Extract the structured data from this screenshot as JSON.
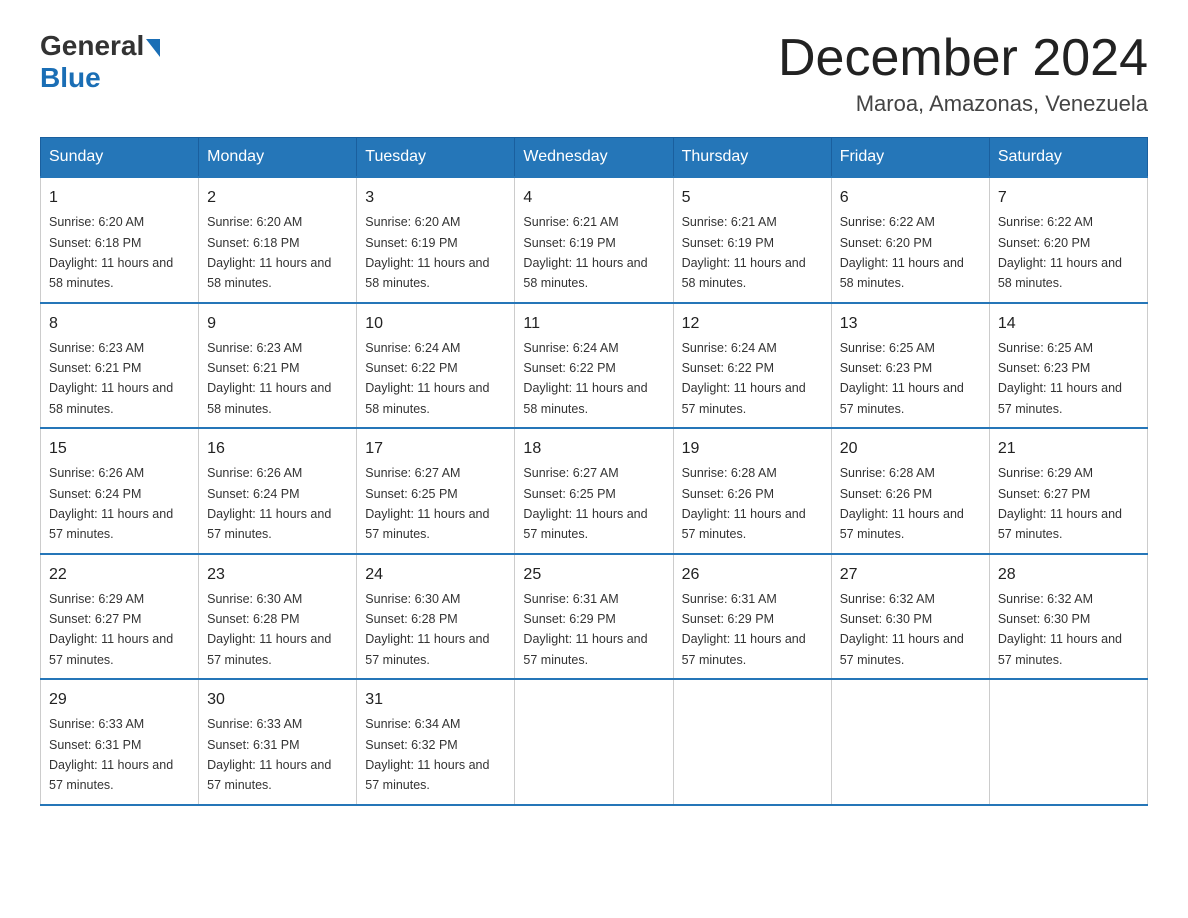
{
  "logo": {
    "general": "General",
    "blue": "Blue"
  },
  "title": "December 2024",
  "subtitle": "Maroa, Amazonas, Venezuela",
  "days_of_week": [
    "Sunday",
    "Monday",
    "Tuesday",
    "Wednesday",
    "Thursday",
    "Friday",
    "Saturday"
  ],
  "weeks": [
    [
      {
        "day": "1",
        "sunrise": "6:20 AM",
        "sunset": "6:18 PM",
        "daylight": "11 hours and 58 minutes."
      },
      {
        "day": "2",
        "sunrise": "6:20 AM",
        "sunset": "6:18 PM",
        "daylight": "11 hours and 58 minutes."
      },
      {
        "day": "3",
        "sunrise": "6:20 AM",
        "sunset": "6:19 PM",
        "daylight": "11 hours and 58 minutes."
      },
      {
        "day": "4",
        "sunrise": "6:21 AM",
        "sunset": "6:19 PM",
        "daylight": "11 hours and 58 minutes."
      },
      {
        "day": "5",
        "sunrise": "6:21 AM",
        "sunset": "6:19 PM",
        "daylight": "11 hours and 58 minutes."
      },
      {
        "day": "6",
        "sunrise": "6:22 AM",
        "sunset": "6:20 PM",
        "daylight": "11 hours and 58 minutes."
      },
      {
        "day": "7",
        "sunrise": "6:22 AM",
        "sunset": "6:20 PM",
        "daylight": "11 hours and 58 minutes."
      }
    ],
    [
      {
        "day": "8",
        "sunrise": "6:23 AM",
        "sunset": "6:21 PM",
        "daylight": "11 hours and 58 minutes."
      },
      {
        "day": "9",
        "sunrise": "6:23 AM",
        "sunset": "6:21 PM",
        "daylight": "11 hours and 58 minutes."
      },
      {
        "day": "10",
        "sunrise": "6:24 AM",
        "sunset": "6:22 PM",
        "daylight": "11 hours and 58 minutes."
      },
      {
        "day": "11",
        "sunrise": "6:24 AM",
        "sunset": "6:22 PM",
        "daylight": "11 hours and 58 minutes."
      },
      {
        "day": "12",
        "sunrise": "6:24 AM",
        "sunset": "6:22 PM",
        "daylight": "11 hours and 57 minutes."
      },
      {
        "day": "13",
        "sunrise": "6:25 AM",
        "sunset": "6:23 PM",
        "daylight": "11 hours and 57 minutes."
      },
      {
        "day": "14",
        "sunrise": "6:25 AM",
        "sunset": "6:23 PM",
        "daylight": "11 hours and 57 minutes."
      }
    ],
    [
      {
        "day": "15",
        "sunrise": "6:26 AM",
        "sunset": "6:24 PM",
        "daylight": "11 hours and 57 minutes."
      },
      {
        "day": "16",
        "sunrise": "6:26 AM",
        "sunset": "6:24 PM",
        "daylight": "11 hours and 57 minutes."
      },
      {
        "day": "17",
        "sunrise": "6:27 AM",
        "sunset": "6:25 PM",
        "daylight": "11 hours and 57 minutes."
      },
      {
        "day": "18",
        "sunrise": "6:27 AM",
        "sunset": "6:25 PM",
        "daylight": "11 hours and 57 minutes."
      },
      {
        "day": "19",
        "sunrise": "6:28 AM",
        "sunset": "6:26 PM",
        "daylight": "11 hours and 57 minutes."
      },
      {
        "day": "20",
        "sunrise": "6:28 AM",
        "sunset": "6:26 PM",
        "daylight": "11 hours and 57 minutes."
      },
      {
        "day": "21",
        "sunrise": "6:29 AM",
        "sunset": "6:27 PM",
        "daylight": "11 hours and 57 minutes."
      }
    ],
    [
      {
        "day": "22",
        "sunrise": "6:29 AM",
        "sunset": "6:27 PM",
        "daylight": "11 hours and 57 minutes."
      },
      {
        "day": "23",
        "sunrise": "6:30 AM",
        "sunset": "6:28 PM",
        "daylight": "11 hours and 57 minutes."
      },
      {
        "day": "24",
        "sunrise": "6:30 AM",
        "sunset": "6:28 PM",
        "daylight": "11 hours and 57 minutes."
      },
      {
        "day": "25",
        "sunrise": "6:31 AM",
        "sunset": "6:29 PM",
        "daylight": "11 hours and 57 minutes."
      },
      {
        "day": "26",
        "sunrise": "6:31 AM",
        "sunset": "6:29 PM",
        "daylight": "11 hours and 57 minutes."
      },
      {
        "day": "27",
        "sunrise": "6:32 AM",
        "sunset": "6:30 PM",
        "daylight": "11 hours and 57 minutes."
      },
      {
        "day": "28",
        "sunrise": "6:32 AM",
        "sunset": "6:30 PM",
        "daylight": "11 hours and 57 minutes."
      }
    ],
    [
      {
        "day": "29",
        "sunrise": "6:33 AM",
        "sunset": "6:31 PM",
        "daylight": "11 hours and 57 minutes."
      },
      {
        "day": "30",
        "sunrise": "6:33 AM",
        "sunset": "6:31 PM",
        "daylight": "11 hours and 57 minutes."
      },
      {
        "day": "31",
        "sunrise": "6:34 AM",
        "sunset": "6:32 PM",
        "daylight": "11 hours and 57 minutes."
      },
      null,
      null,
      null,
      null
    ]
  ]
}
